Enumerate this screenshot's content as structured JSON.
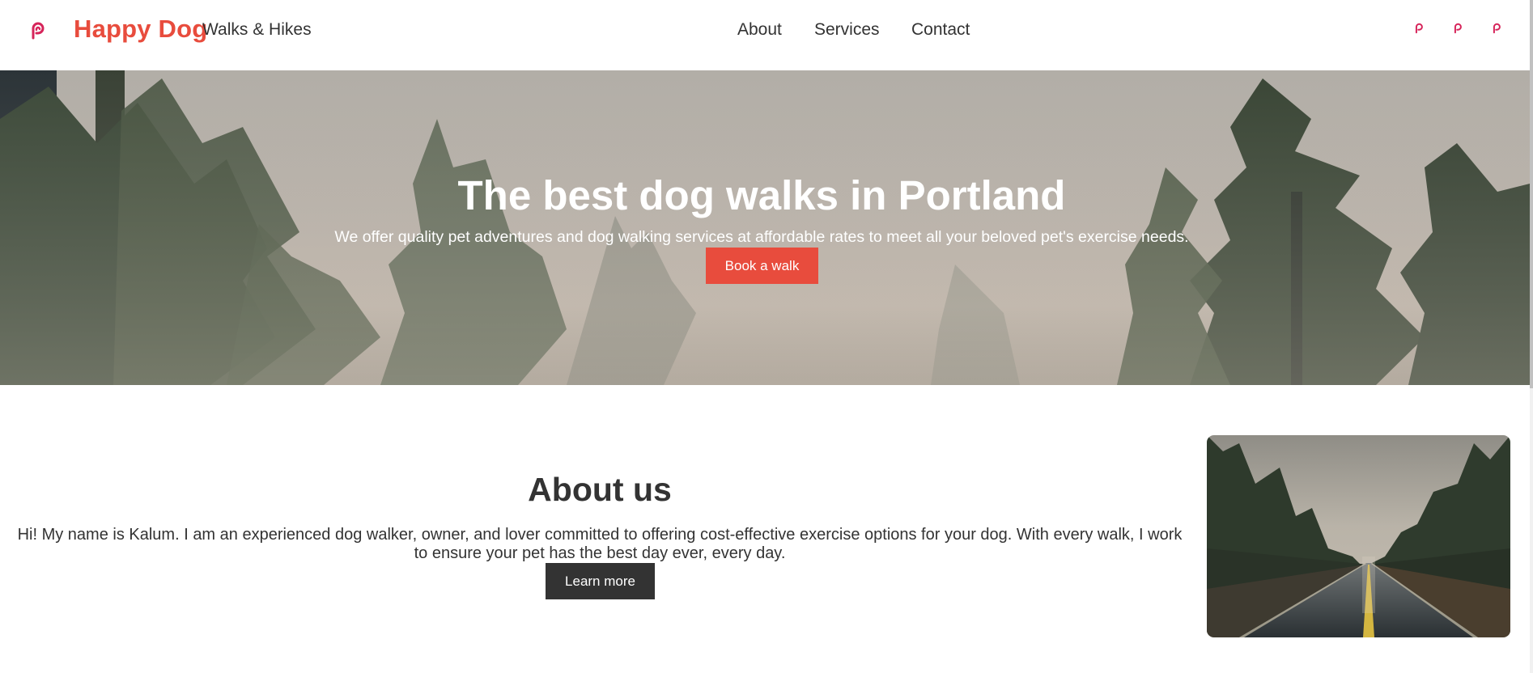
{
  "header": {
    "logo_icon": "parse-logo-icon",
    "brand": "Happy Dog",
    "tagline": "Walks & Hikes",
    "nav": [
      {
        "label": "About"
      },
      {
        "label": "Services"
      },
      {
        "label": "Contact"
      }
    ],
    "social_icons": [
      "social-link-icon",
      "social-link-icon",
      "social-link-icon"
    ]
  },
  "hero": {
    "title": "The best dog walks in Portland",
    "subtitle": "We offer quality pet adventures and dog walking services at affordable rates to meet all your beloved pet's exercise needs.",
    "cta_label": "Book a walk"
  },
  "about": {
    "title": "About us",
    "text": "Hi! My name is Kalum. I am an experienced dog walker, owner, and lover committed to offering cost-effective exercise options for your dog. With every walk, I work to ensure your pet has the best day ever, every day.",
    "cta_label": "Learn more"
  },
  "colors": {
    "accent": "#e84c3d",
    "logo": "#d6245a",
    "dark_button": "#333333",
    "text": "#333333"
  }
}
